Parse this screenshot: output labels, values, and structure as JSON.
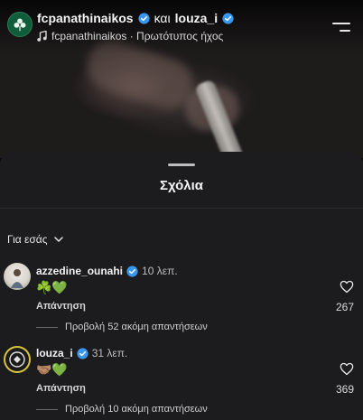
{
  "header": {
    "account_primary": "fcpanathinaikos",
    "connector": "και",
    "account_secondary": "louza_i",
    "audio_label": "fcpanathinaikos · Πρωτότυπος ήχος"
  },
  "sheet": {
    "title": "Σχόλια",
    "filter_label": "Για εσάς"
  },
  "comments": [
    {
      "username": "azzedine_ounahi",
      "time": "10 λεπ.",
      "text": "☘️💚",
      "reply_label": "Απάντηση",
      "likes": "267",
      "more_replies": "Προβολή 52 ακόμη απαντήσεων"
    },
    {
      "username": "louza_i",
      "time": "31 λεπ.",
      "text": "🤝🏽💚",
      "reply_label": "Απάντηση",
      "likes": "369",
      "more_replies": "Προβολή 10 ακόμη απαντήσεων"
    }
  ],
  "colors": {
    "verified": "#3897f0",
    "sheet_bg": "#1c1c1e",
    "panathinaikos_green": "#0f5d3a"
  },
  "icons": [
    "verified-icon",
    "music-note-icon",
    "menu-icon",
    "chevron-down-icon",
    "heart-icon"
  ]
}
